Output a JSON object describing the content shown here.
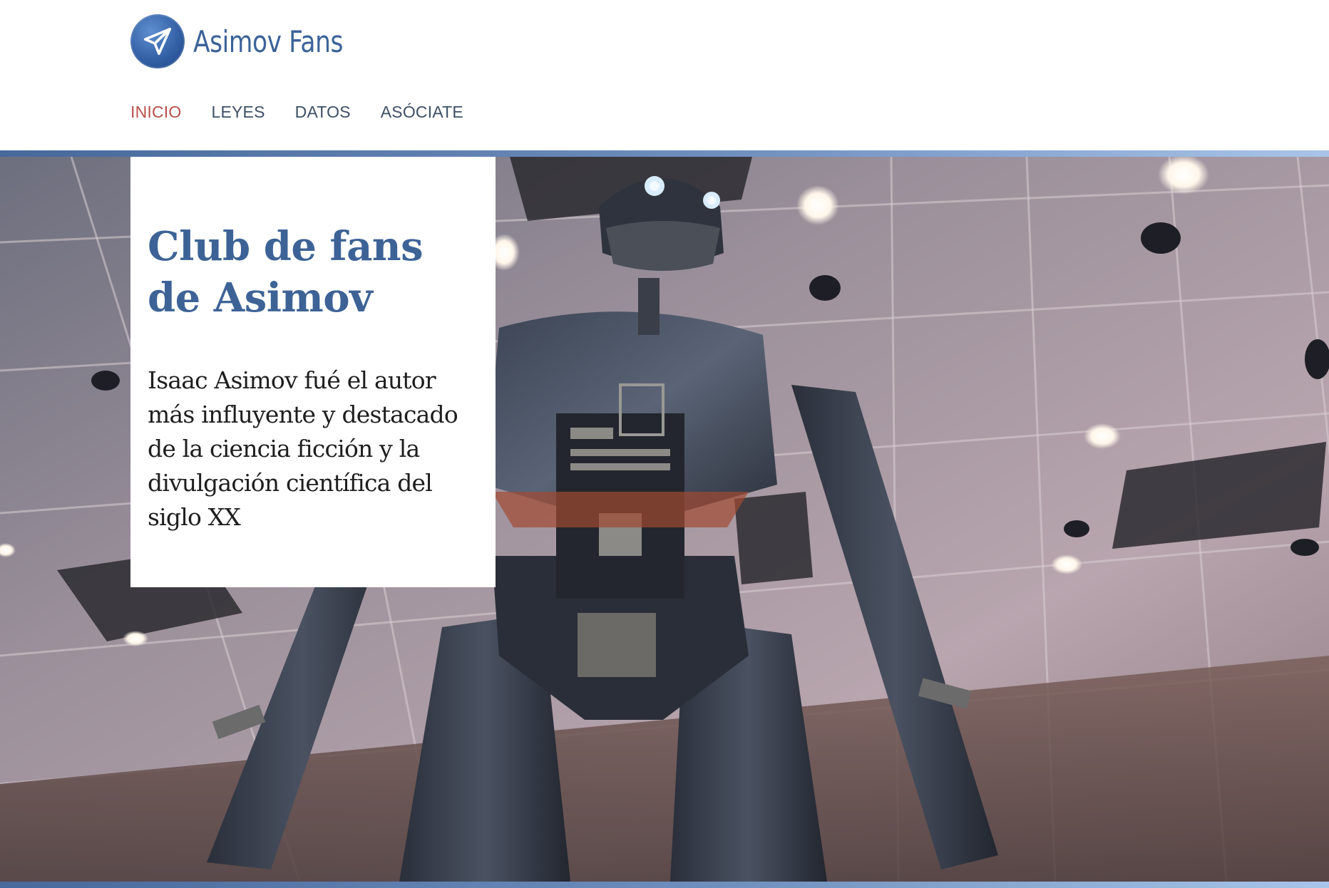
{
  "site": {
    "name": "Asimov Fans"
  },
  "nav": {
    "items": [
      {
        "label": "INICIO",
        "active": true
      },
      {
        "label": "LEYES",
        "active": false
      },
      {
        "label": "DATOS",
        "active": false
      },
      {
        "label": "ASÓCIATE",
        "active": false
      }
    ]
  },
  "hero": {
    "title": "Club de fans de Asimov",
    "text": "Isaac Asimov fué el autor más influyente y destacado de la ciencia ficción y la divulgación científica del siglo XX"
  },
  "colors": {
    "brand_blue": "#3d6396",
    "nav_active": "#b9504b",
    "nav_text": "#3d4f66",
    "accent_bar": "#6f8fbe"
  },
  "icons": {
    "logo": "paper-plane-icon"
  }
}
